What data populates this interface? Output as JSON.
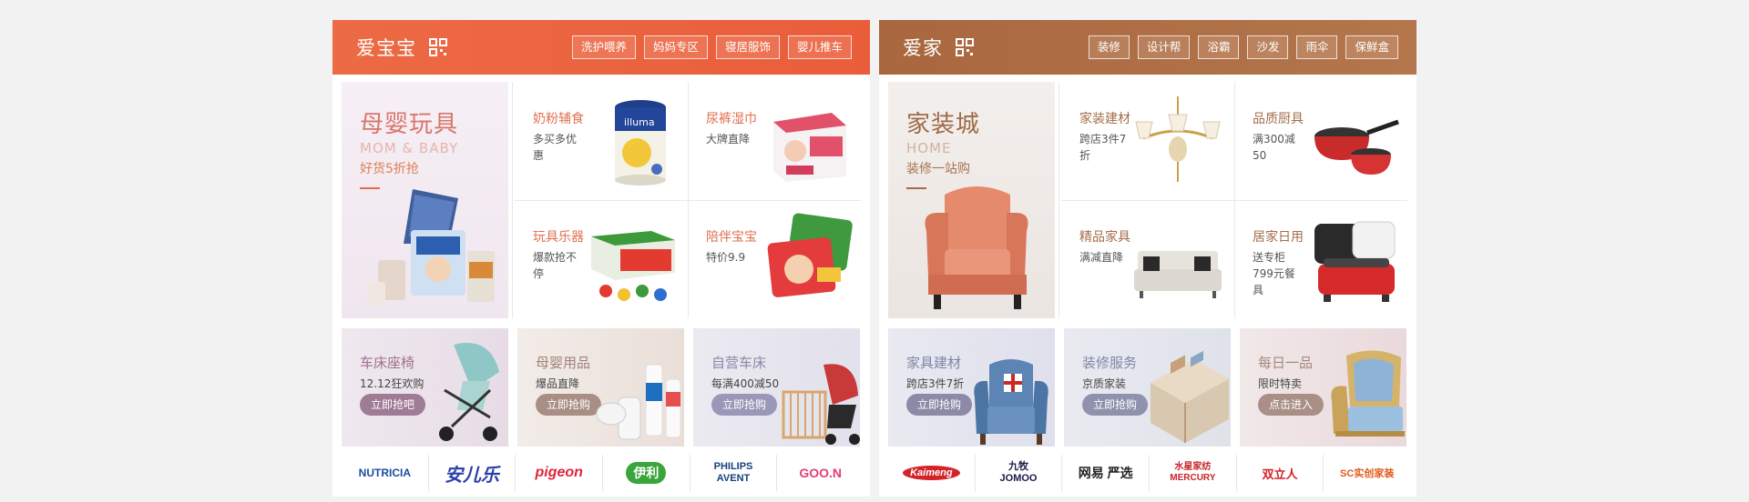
{
  "baby": {
    "title": "爱宝宝",
    "tags": [
      "洗护喂养",
      "妈妈专区",
      "寝居服饰",
      "婴儿推车"
    ],
    "hero": {
      "title": "母婴玩具",
      "en": "MOM & BABY",
      "sub": "好货5折抢"
    },
    "cells": [
      {
        "title": "奶粉辅食",
        "desc": "多买多优惠"
      },
      {
        "title": "尿裤湿巾",
        "desc": "大牌直降"
      },
      {
        "title": "玩具乐器",
        "desc": "爆款抢不停"
      },
      {
        "title": "陪伴宝宝",
        "desc": "特价9.9"
      }
    ],
    "promos": [
      {
        "title": "车床座椅",
        "desc": "12.12狂欢购",
        "button": "立即抢吧"
      },
      {
        "title": "母婴用品",
        "desc": "爆品直降",
        "button": "立即抢购"
      },
      {
        "title": "自营车床",
        "desc": "每满400减50",
        "button": "立即抢购"
      }
    ],
    "brands": [
      "NUTRICIA",
      "安儿乐",
      "pigeon",
      "伊利",
      "PHILIPS AVENT",
      "GOO.N"
    ]
  },
  "home": {
    "title": "爱家",
    "tags": [
      "装修",
      "设计帮",
      "浴霸",
      "沙发",
      "雨伞",
      "保鲜盒"
    ],
    "hero": {
      "title": "家装城",
      "en": "HOME",
      "sub": "装修一站购"
    },
    "cells": [
      {
        "title": "家装建材",
        "desc": "跨店3件7折"
      },
      {
        "title": "品质厨具",
        "desc": "满300减50"
      },
      {
        "title": "精品家具",
        "desc": "满减直降"
      },
      {
        "title": "居家日用",
        "desc": "送专柜799元餐具"
      }
    ],
    "promos": [
      {
        "title": "家具建材",
        "desc": "跨店3件7折",
        "button": "立即抢购"
      },
      {
        "title": "装修服务",
        "desc": "京质家装",
        "button": "立即抢购"
      },
      {
        "title": "每日一品",
        "desc": "限时特卖",
        "button": "点击进入"
      }
    ],
    "brands": [
      "Kaimeng",
      "九牧 JOMOO",
      "网易 严选",
      "水星家纺 MERCURY",
      "双立人",
      "SC实创家装"
    ]
  },
  "colors": {
    "baby_header": "#ea6340",
    "home_header": "#ae6e45",
    "baby_button": "#a07b95",
    "home_button": "#8c8aa6"
  }
}
